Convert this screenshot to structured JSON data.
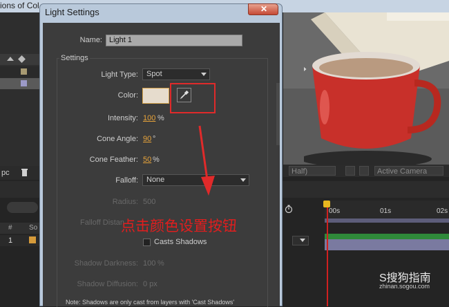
{
  "background_app": {
    "title_fragment": "ions of Col",
    "left_panel": {
      "bottom_label": "pc"
    },
    "viewer_toolbar": {
      "resolution": "Half)",
      "camera": "Active Camera"
    },
    "timeline": {
      "col_hash": "#",
      "col_source": "So",
      "row_number": "1",
      "ruler_labels": [
        "00s",
        "01s",
        "02s"
      ]
    }
  },
  "dialog": {
    "title": "Light Settings",
    "close_glyph": "✕",
    "name_label": "Name:",
    "name_value": "Light 1",
    "settings_group_label": "Settings",
    "light_type": {
      "label": "Light Type:",
      "value": "Spot"
    },
    "color": {
      "label": "Color:",
      "swatch": "#e6dccd"
    },
    "intensity": {
      "label": "Intensity:",
      "value": "100",
      "unit": "%"
    },
    "cone_angle": {
      "label": "Cone Angle:",
      "value": "90",
      "unit": "°"
    },
    "cone_feather": {
      "label": "Cone Feather:",
      "value": "50",
      "unit": "%"
    },
    "falloff": {
      "label": "Falloff:",
      "value": "None"
    },
    "radius": {
      "label": "Radius:",
      "value": "500"
    },
    "falloff_distance": {
      "label": "Falloff Distan"
    },
    "cast_shadows": {
      "label": "Casts Shadows",
      "checked": false
    },
    "shadow_darkness": {
      "label": "Shadow Darkness:",
      "value": "100",
      "unit": "%"
    },
    "shadow_diffusion": {
      "label": "Shadow Diffusion:",
      "value": "0 px"
    },
    "note": "Note: Shadows are only cast from layers with 'Cast Shadows'"
  },
  "annotation": {
    "text": "点击颜色设置按钮",
    "color": "#e01e1e"
  },
  "watermark": {
    "logo": "S搜狗指南",
    "url": "zhinan.sogou.com"
  }
}
